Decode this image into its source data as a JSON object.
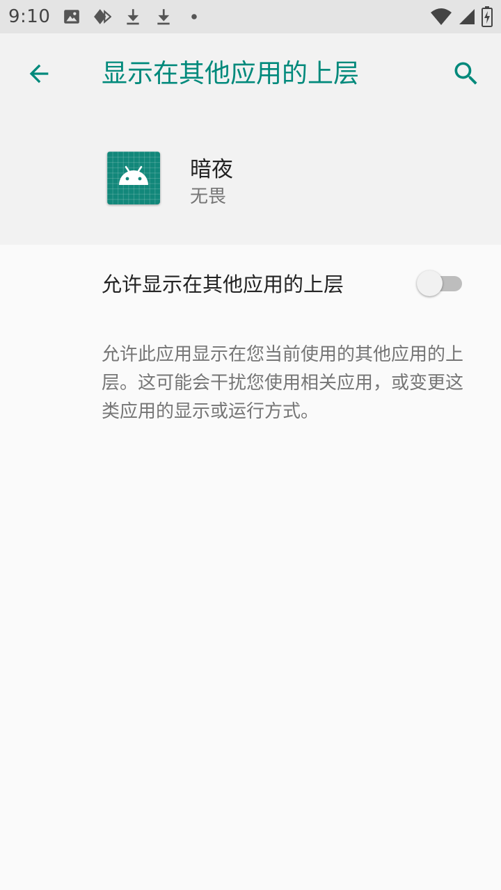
{
  "status_bar": {
    "time": "9:10",
    "left_icons": [
      "image-icon",
      "data-saver-icon",
      "download-icon",
      "download-icon",
      "dot-icon"
    ],
    "right_icons": [
      "wifi-icon",
      "cell-signal-icon",
      "battery-charging-icon"
    ]
  },
  "header": {
    "title": "显示在其他应用的上层",
    "back_icon": "arrow-back-icon",
    "search_icon": "search-icon"
  },
  "app": {
    "name": "暗夜",
    "subtitle": "无畏",
    "icon": "android-app-icon"
  },
  "permission": {
    "label": "允许显示在其他应用的上层",
    "enabled": false,
    "description": "允许此应用显示在您当前使用的其他应用的上层。这可能会干扰您使用相关应用，或变更这类应用的显示或运行方式。"
  },
  "colors": {
    "accent": "#00897b",
    "header_bg": "#f2f2f2",
    "status_bar_bg": "#e4e4e4",
    "page_bg": "#fafafa",
    "app_icon_bg": "#12877a"
  }
}
